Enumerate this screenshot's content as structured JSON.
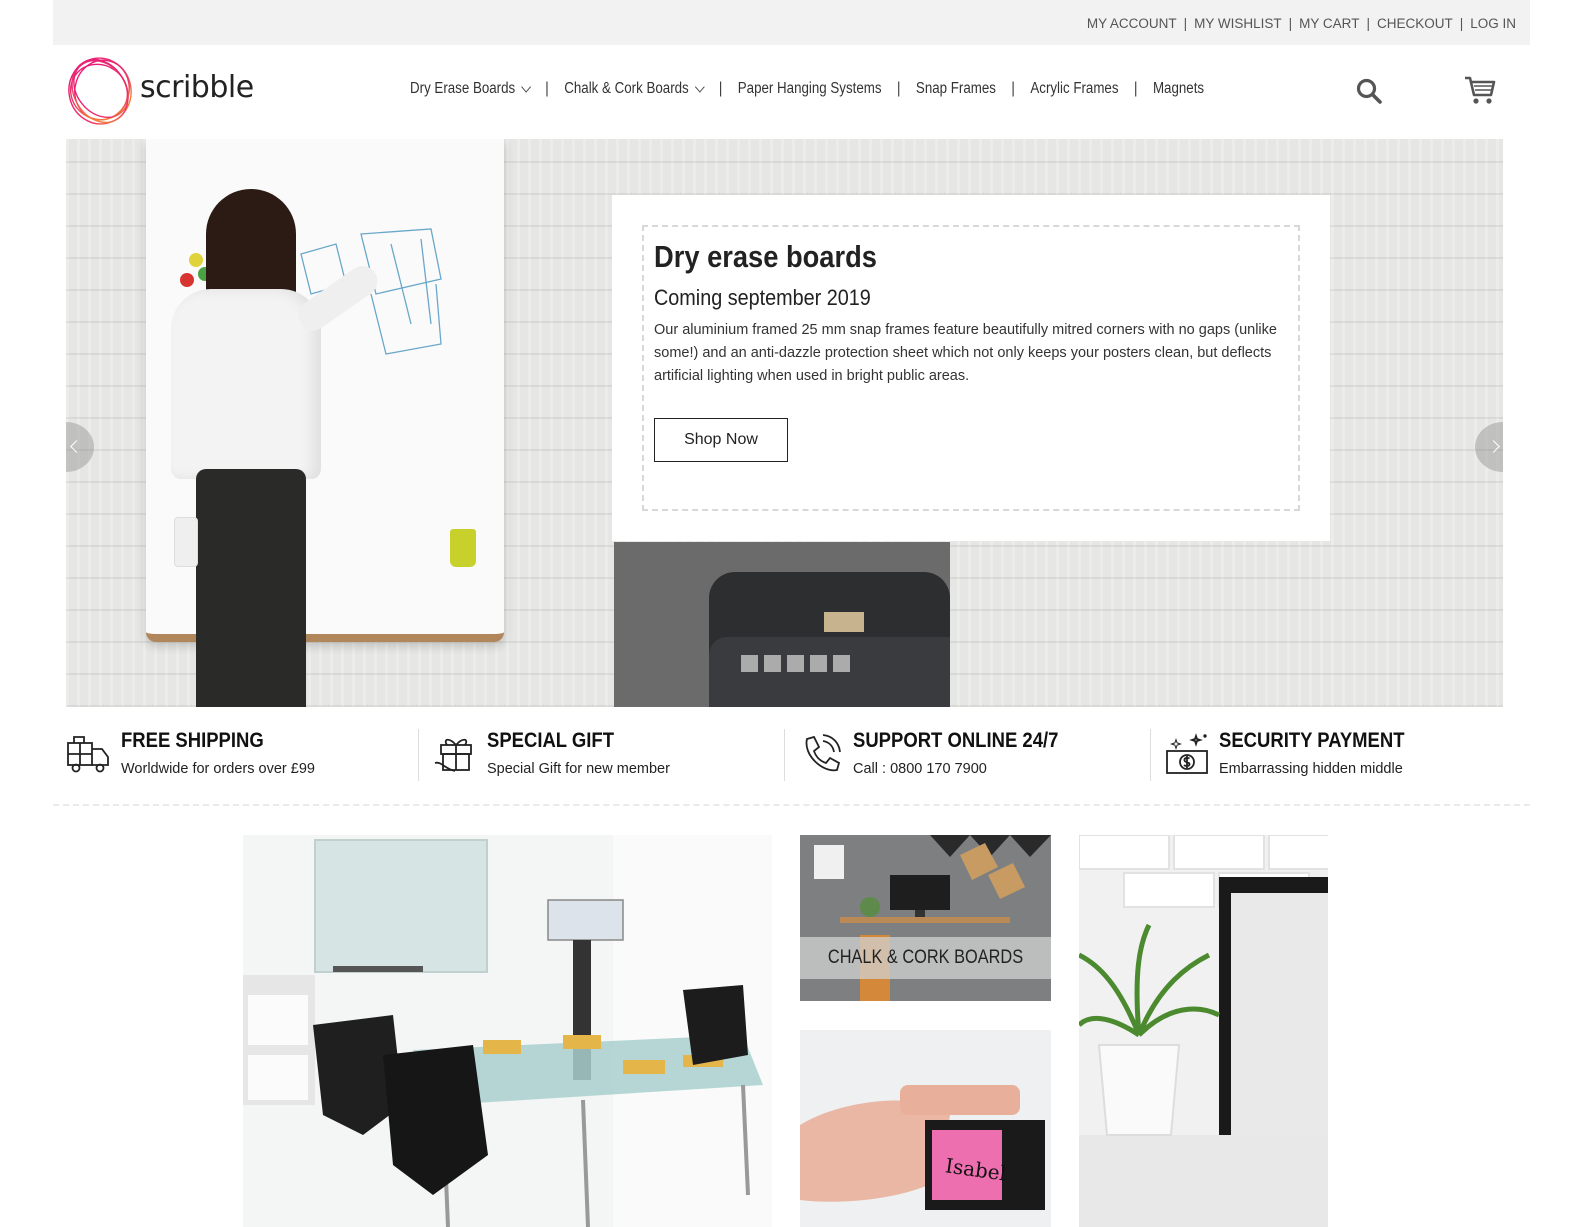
{
  "top_links": [
    "MY ACCOUNT",
    "MY WISHLIST",
    "MY CART",
    "CHECKOUT",
    "LOG IN"
  ],
  "brand": {
    "name": "scribble",
    "accent": "#e6127b"
  },
  "nav": {
    "items": [
      {
        "label": "Dry Erase Boards",
        "dropdown": true
      },
      {
        "label": "Chalk & Cork Boards",
        "dropdown": true
      },
      {
        "label": "Paper Hanging Systems",
        "dropdown": false
      },
      {
        "label": "Snap Frames",
        "dropdown": false
      },
      {
        "label": "Acrylic Frames",
        "dropdown": false
      },
      {
        "label": "Magnets",
        "dropdown": false
      }
    ],
    "separator": "|",
    "search_icon": "search-icon",
    "cart_icon": "cart-icon"
  },
  "hero": {
    "title": "Dry erase boards",
    "subtitle": "Coming september 2019",
    "body": "Our aluminium framed 25 mm snap frames feature beautifully mitred corners with no gaps (unlike some!) and an anti-dazzle protection sheet which not only keeps your posters clean, but deflects artificial lighting when used in bright public areas.",
    "button_label": "Shop Now",
    "slide_count": 5
  },
  "features": [
    {
      "icon": "truck-icon",
      "title": "FREE SHIPPING",
      "desc": "Worldwide for orders over £99"
    },
    {
      "icon": "gift-icon",
      "title": "SPECIAL GIFT",
      "desc": "Special Gift for new member"
    },
    {
      "icon": "phone-icon",
      "title": "SUPPORT ONLINE 24/7",
      "desc": "Call : 0800 170 7900"
    },
    {
      "icon": "money-icon",
      "title": "SECURITY PAYMENT",
      "desc": "Embarrassing hidden middle"
    }
  ],
  "categories": {
    "chalk_label": "CHALK & CORK BOARDS",
    "name_badge_text": "Isabel"
  }
}
